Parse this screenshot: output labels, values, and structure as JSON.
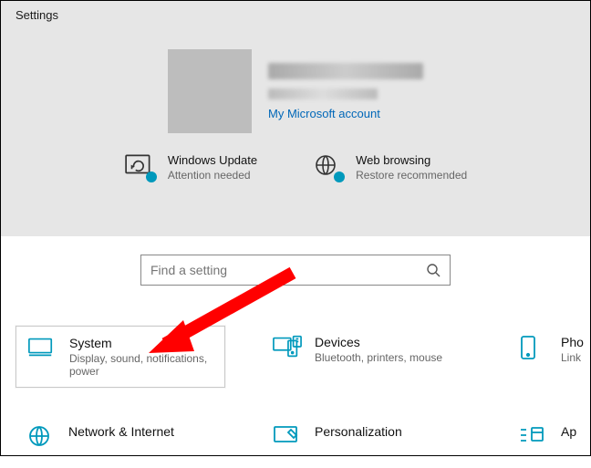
{
  "window_title": "Settings",
  "account": {
    "name_redacted": true,
    "email_redacted": true,
    "link_label": "My Microsoft account"
  },
  "status_tiles": [
    {
      "icon": "update-sync-icon",
      "title": "Windows Update",
      "subtitle": "Attention needed"
    },
    {
      "icon": "globe-icon",
      "title": "Web browsing",
      "subtitle": "Restore recommended"
    }
  ],
  "search": {
    "placeholder": "Find a setting"
  },
  "categories_row1": [
    {
      "icon": "monitor-icon",
      "title": "System",
      "subtitle": "Display, sound, notifications, power",
      "selected": true
    },
    {
      "icon": "devices-icon",
      "title": "Devices",
      "subtitle": "Bluetooth, printers, mouse"
    },
    {
      "icon": "phone-icon",
      "title": "Phone",
      "subtitle": "Link your phone",
      "truncated": true
    }
  ],
  "categories_row2": [
    {
      "icon": "globe-icon",
      "title": "Network & Internet",
      "subtitle": ""
    },
    {
      "icon": "personalize-icon",
      "title": "Personalization",
      "subtitle": ""
    },
    {
      "icon": "apps-icon",
      "title": "Apps",
      "subtitle": "",
      "truncated": true
    }
  ],
  "annotation": {
    "type": "red-arrow",
    "points_to": "category-system"
  },
  "colors": {
    "accent": "#0099bc",
    "link": "#0067b8",
    "header_bg": "#e6e6e6"
  }
}
